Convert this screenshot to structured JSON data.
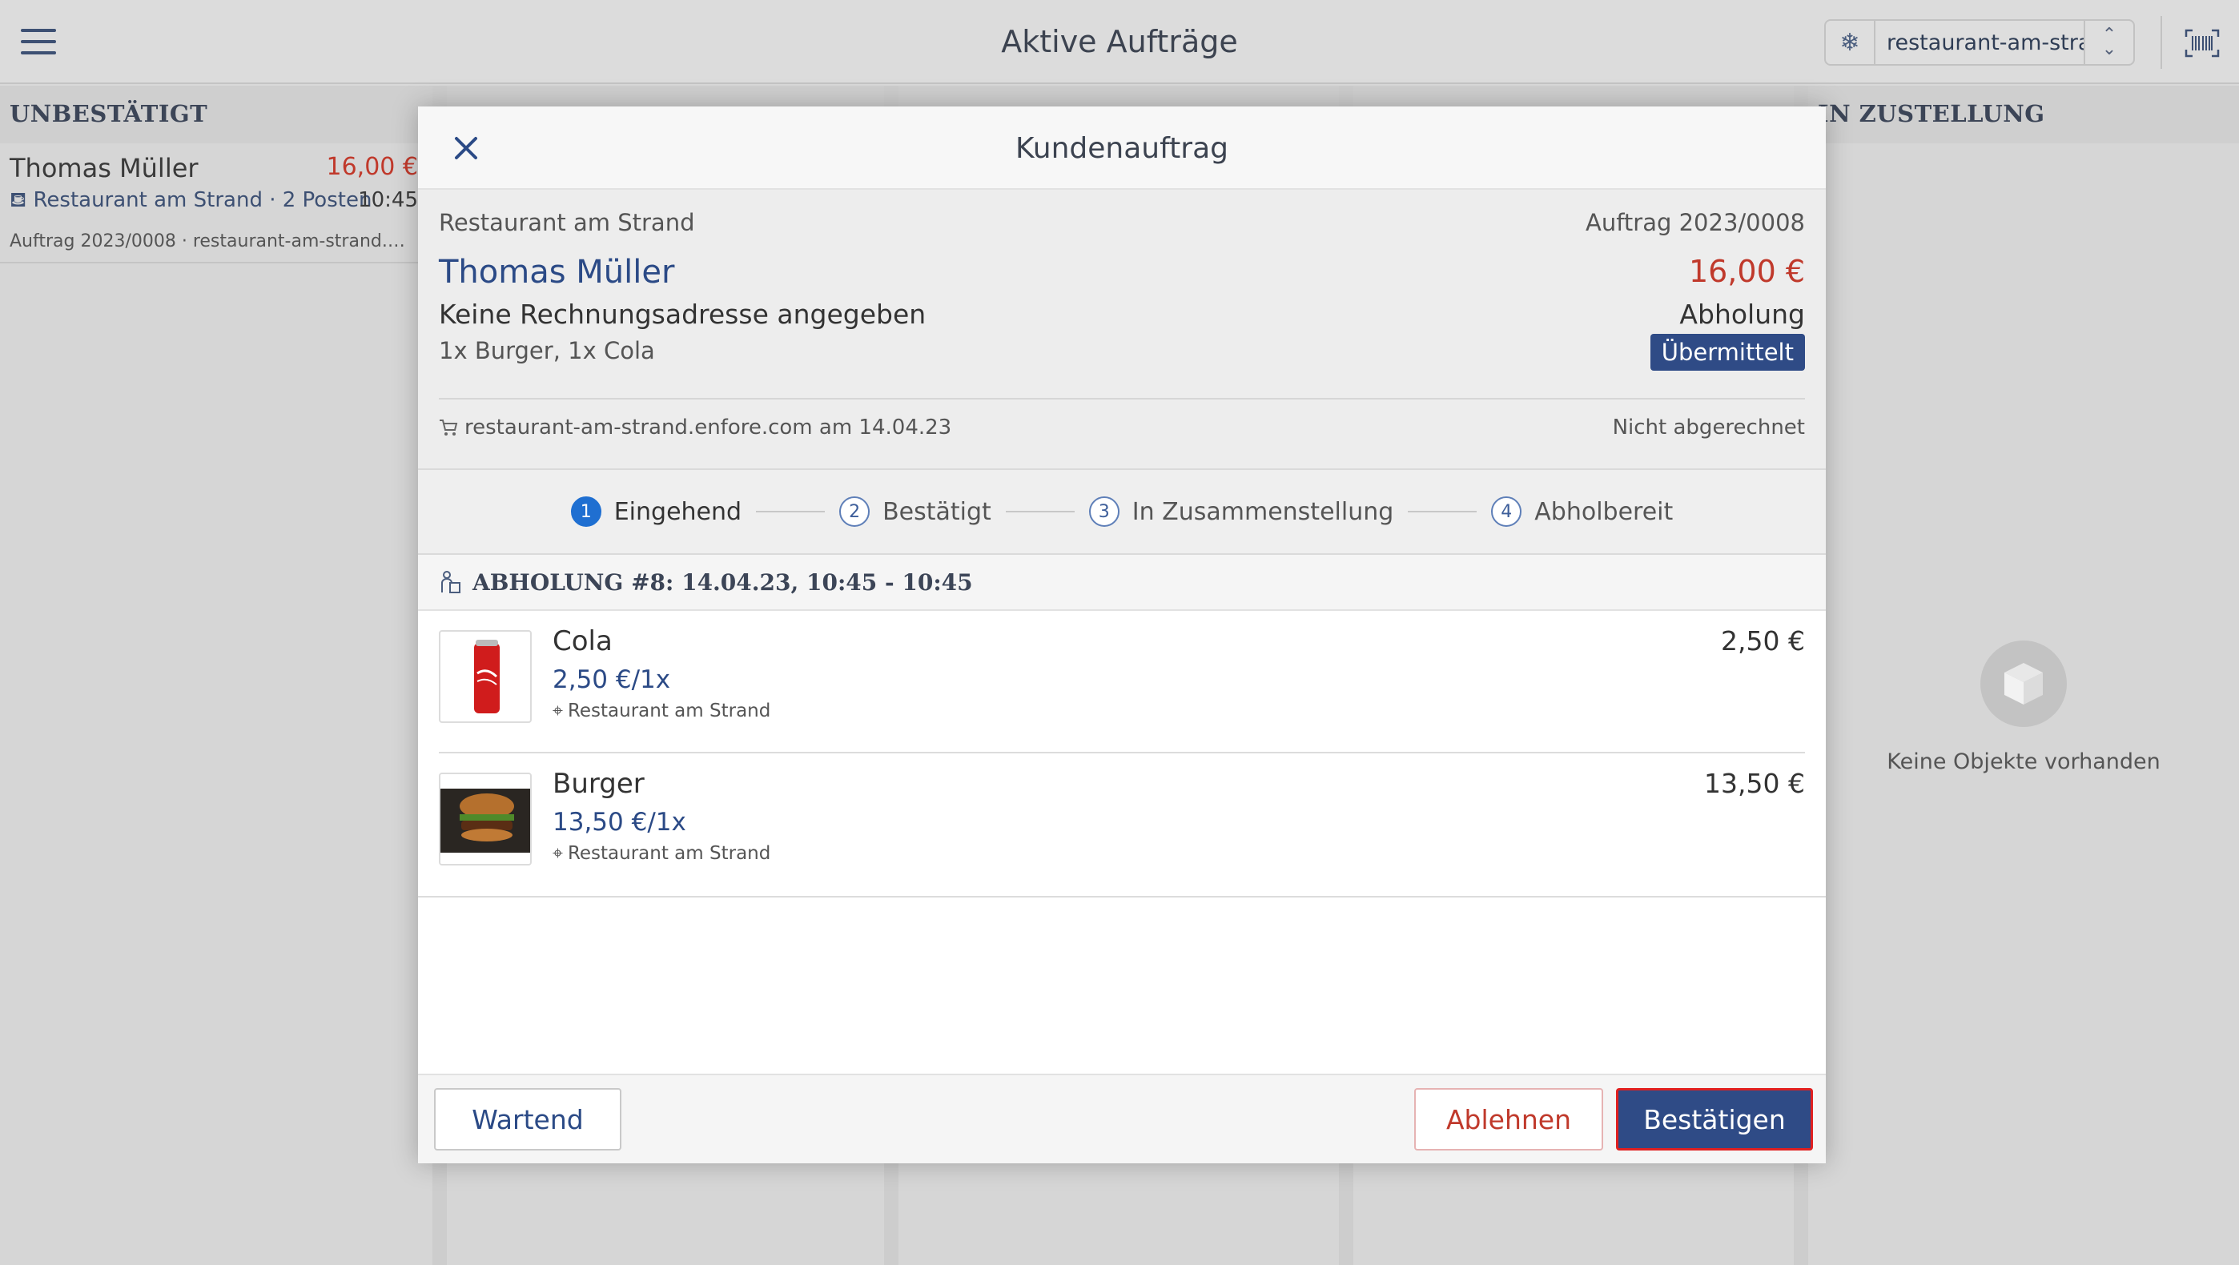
{
  "app": {
    "title": "Aktive Aufträge",
    "store_select_value": "restaurant-am-stra..."
  },
  "columns": [
    {
      "label": "UNBESTÄTIGT"
    },
    {
      "label": "IN ZUSTELLUNG"
    }
  ],
  "background_order": {
    "customer": "Thomas Müller",
    "price": "16,00 €",
    "meta": "Restaurant am Strand · 2 Posten",
    "time": "10:45",
    "sub": "Auftrag 2023/0008 · restaurant-am-strand.enfor..."
  },
  "empty_state": {
    "text": "Keine Objekte vorhanden"
  },
  "modal": {
    "title": "Kundenauftrag",
    "shop": "Restaurant am Strand",
    "order_number": "Auftrag 2023/0008",
    "customer": "Thomas Müller",
    "total": "16,00 €",
    "address": "Keine Rechnungsadresse angegeben",
    "method": "Abholung",
    "items_summary": "1x Burger, 1x Cola",
    "status_badge": "Übermittelt",
    "source": "restaurant-am-strand.enfore.com am 14.04.23",
    "billing_status": "Nicht abgerechnet",
    "steps": [
      {
        "num": "1",
        "label": "Eingehend"
      },
      {
        "num": "2",
        "label": "Bestätigt"
      },
      {
        "num": "3",
        "label": "In Zusammenstellung"
      },
      {
        "num": "4",
        "label": "Abholbereit"
      }
    ],
    "section_title": "ABHOLUNG #8: 14.04.23, 10:45 - 10:45",
    "line_items": [
      {
        "name": "Cola",
        "unit_price": "2,50 €/1x",
        "location": "Restaurant am Strand",
        "price": "2,50 €"
      },
      {
        "name": "Burger",
        "unit_price": "13,50 €/1x",
        "location": "Restaurant am Strand",
        "price": "13,50 €"
      }
    ],
    "buttons": {
      "wait": "Wartend",
      "reject": "Ablehnen",
      "confirm": "Bestätigen"
    }
  },
  "colors": {
    "accent": "#2f4b86",
    "price_red": "#c0392b",
    "active_step": "#1f6fd1"
  }
}
